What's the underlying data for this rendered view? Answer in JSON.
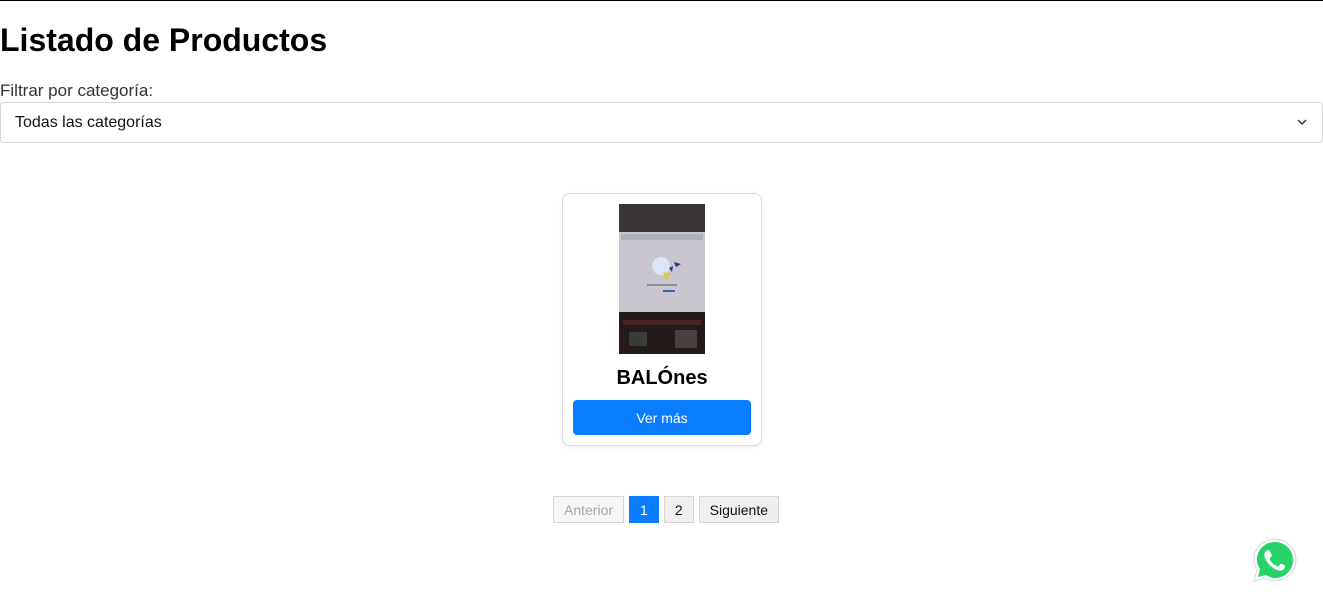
{
  "header": {
    "title": "Listado de Productos"
  },
  "filter": {
    "label": "Filtrar por categoría:",
    "selected": "Todas las categorías",
    "chevron_icon": "chevron-down-icon"
  },
  "products": [
    {
      "name": "BALÓnes",
      "button_label": "Ver más"
    }
  ],
  "pagination": {
    "prev_label": "Anterior",
    "pages": [
      "1",
      "2"
    ],
    "current_page": "1",
    "next_label": "Siguiente"
  },
  "floating": {
    "icon": "whatsapp-icon"
  },
  "colors": {
    "primary": "#0a7cff",
    "whatsapp_green": "#25d366"
  }
}
